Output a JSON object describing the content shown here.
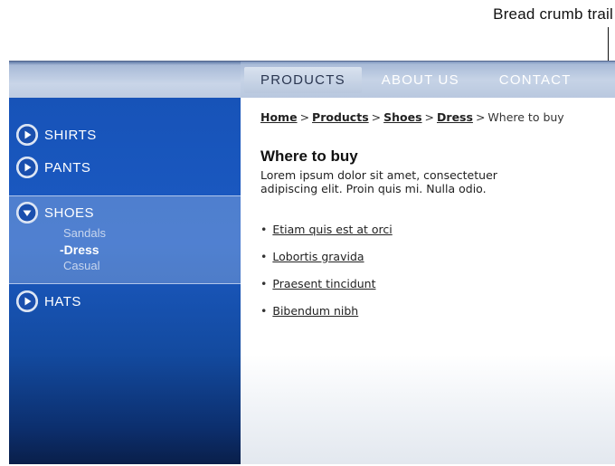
{
  "callout": {
    "label": "Bread crumb trail"
  },
  "nav": {
    "items": [
      {
        "label": "PRODUCTS"
      },
      {
        "label": "ABOUT US"
      },
      {
        "label": "CONTACT"
      }
    ]
  },
  "sidebar": {
    "items": [
      {
        "label": "SHIRTS"
      },
      {
        "label": "PANTS"
      },
      {
        "label": "SHOES"
      },
      {
        "label": "HATS"
      }
    ],
    "shoes_sub": [
      {
        "label": "Sandals"
      },
      {
        "label": "-Dress"
      },
      {
        "label": "Casual"
      }
    ]
  },
  "breadcrumb": {
    "home": "Home",
    "products": "Products",
    "shoes": "Shoes",
    "dress": "Dress",
    "current": "Where to buy",
    "separator": ">"
  },
  "content": {
    "title": "Where to buy",
    "intro": "Lorem ipsum dolor sit amet, consectetuer adipiscing elit. Proin quis mi. Nulla odio.",
    "links": [
      {
        "label": "Etiam quis est at orci"
      },
      {
        "label": "Lobortis gravida"
      },
      {
        "label": "Praesent tincidunt"
      },
      {
        "label": "Bibendum nibh"
      }
    ]
  },
  "colors": {
    "sidebar_blue": "#1753b8",
    "nav_active_bg": "#d9e2ef"
  }
}
